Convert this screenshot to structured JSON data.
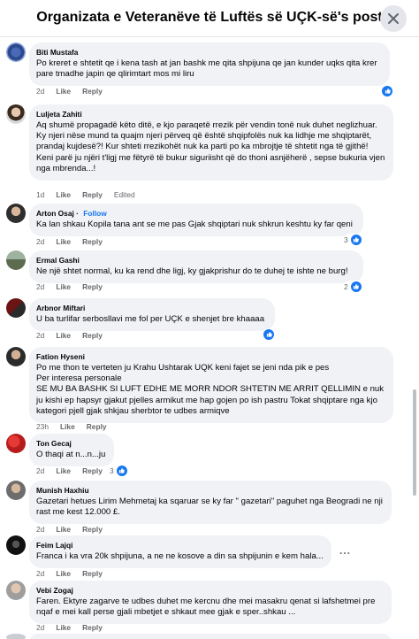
{
  "header": {
    "title": "Organizata e Veteranëve të Luftës së UÇK-së's post"
  },
  "icons": {
    "close": "close-icon",
    "like": "like-icon",
    "more": "more-options-icon"
  },
  "colors": {
    "accent": "#1877f2",
    "bubble": "#f0f2f5",
    "meta": "#65676b"
  },
  "labels": {
    "like": "Like",
    "reply": "Reply",
    "edited": "Edited",
    "follow": "Follow",
    "more": "..."
  },
  "comments": [
    {
      "author": "Biti Mustafa",
      "text": "Po kreret e shtetit qe i kena tash at jan bashk me qita shpijuna qe jan kunder uqks qita krer pare tmadhe japin qe qlirimtart mos mi liru",
      "time": "2d"
    },
    {
      "author": "Luljeta Zahiti",
      "text": "Aq shumë propagadë këto ditë, e kjo paraqetë rrezik për vendin tonë nuk duhet neglizhuar.\nKy njeri nëse mund ta quajm njeri përveq që është shqipfolës nuk ka lidhje me shqiptarët, prandaj kujdesë?! Kur shteti rrezikohët nuk ka parti po ka mbrojtje të shtetit nga të gjithë! Keni parë ju njëri t'ligj me fëtyrë të bukur siguriisht që do thoni asnjëherë , sepse bukuria vjen nga mbrenda...!",
      "time": "1d"
    },
    {
      "author": "Arton Osaj",
      "text": "Ka lan shkau Kopila tana ant se me pas Gjak shqiptari nuk shkrun keshtu ky far qeni",
      "time": "2d",
      "reactions": "3"
    },
    {
      "author": "Ermal Gashi",
      "text": "Ne një shtet normal, ku ka rend dhe ligj, ky gjakprishur do te duhej te ishte ne burg!",
      "time": "2d",
      "reactions": "2"
    },
    {
      "author": "Arbnor Miftari",
      "text": "U ba turlifar serbosllavi me fol per UÇK e shenjet bre khaaaa",
      "time": "2d"
    },
    {
      "author": "Fation Hyseni",
      "text": "Po me thon te verteten ju Krahu Ushtarak UQK keni fajet se jeni nda pik e pes\nPer interesa personale\nSE MU BA BASHK SI LUFT EDHE ME MORR NDOR SHTETIN ME ARRIT QELLIMIN e nuk ju kishi ep hapsyr gjakut pjelles armikut me hap gojen po ish pastru Tokat shqiptare nga kjo kategori pjell gjak shkjau sherbtor te udbes armiqve",
      "time": "23h"
    },
    {
      "author": "Ton Gecaj",
      "text": "O thaqi at n...n...ju",
      "time": "2d",
      "reactions": "3"
    },
    {
      "author": "Munish Haxhiu",
      "text": "Gazetari hetues Lirim Mehmetaj ka sqaruar se ky far \" gazetari\" paguhet nga Beogradi ne nji rast me kest 12.000 £.",
      "time": "2d"
    },
    {
      "author": "Feim Lajqi",
      "text": "Franca i ka vra 20k shpijuna, a ne ne kosove a din sa shpijunin e kem hala...",
      "time": "2d"
    },
    {
      "author": "Vebi Zogaj",
      "text": "Faren. Ektyre zagarve te udbes duhet me kercnu dhe mei masakru qenat si lafshetmei pre nqaf e mei kall perse gjali mbetjet e shkaut mee gjak e sper..shkau ...",
      "time": "2d"
    }
  ]
}
